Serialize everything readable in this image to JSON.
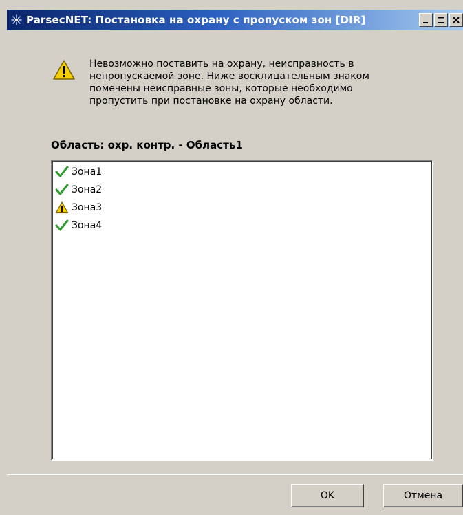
{
  "window": {
    "title": "ParsecNET: Постановка на охрану с пропуском зон [DIR]",
    "title_gradient_start": "#0a246a",
    "title_gradient_end": "#a6caf0",
    "face_color": "#d4d0c8",
    "caption_buttons": [
      "minimize-icon",
      "maximize-icon",
      "close-icon"
    ]
  },
  "dialog": {
    "icon": "warning-icon",
    "message": "Невозможно поставить на охрану, неисправность в\nнепропускаемой зоне. Ниже восклицательным знаком\nпомечены неисправные зоны, которые необходимо\nпропустить при постановке на охрану области.",
    "area_label": "Область: охр. контр. - Область1"
  },
  "zones": [
    {
      "label": "Зона1",
      "status": "ok",
      "icon": "check-icon"
    },
    {
      "label": "Зона2",
      "status": "ok",
      "icon": "check-icon"
    },
    {
      "label": "Зона3",
      "status": "fault",
      "icon": "warning-icon"
    },
    {
      "label": "Зона4",
      "status": "ok",
      "icon": "check-icon"
    }
  ],
  "buttons": {
    "ok_label": "OK",
    "cancel_label": "Отмена"
  },
  "colors": {
    "check": "#2e9a2e",
    "warning_fill": "#f5d000",
    "warning_border": "#7a6000"
  }
}
